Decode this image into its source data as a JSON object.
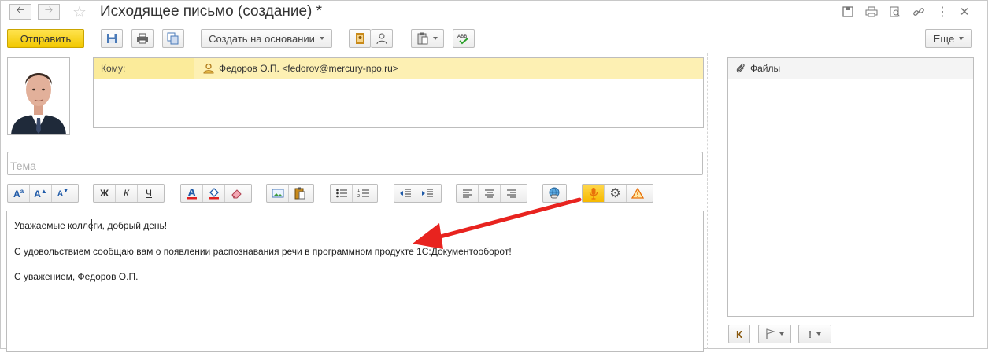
{
  "window": {
    "title": "Исходящее письмо (создание) *"
  },
  "toolbar": {
    "send_label": "Отправить",
    "create_based_label": "Создать на основании",
    "more_label": "Еще"
  },
  "recipients": {
    "to_label": "Кому:",
    "to_value": "Федоров О.П. <fedorov@mercury-npo.ru>"
  },
  "subject": {
    "placeholder": "Тема",
    "value": ""
  },
  "format_toolbar": {
    "bold": "Ж",
    "italic": "К",
    "underline": "Ч"
  },
  "body": {
    "line1": "Уважаемые коллеги, добрый день!",
    "line2": "С удовольствием сообщаю вам о появлении распознавания  речи в программном продукте 1С:Документооборот!",
    "line3": "С уважением, Федоров О.П."
  },
  "files": {
    "title": "Файлы"
  },
  "bottom_buttons": {
    "k_label": "К",
    "exclaim_label": "!"
  },
  "colors": {
    "accent_yellow": "#f6c800",
    "recipient_highlight": "#fbeb9a",
    "annotation_arrow": "#e8231f"
  },
  "icons": [
    "back-icon",
    "forward-icon",
    "star-icon",
    "save-icon",
    "print-icon",
    "copy-icon",
    "clipboard-icon",
    "spellcheck-icon",
    "microphone-icon",
    "gear-icon",
    "warning-icon",
    "paperclip-icon",
    "flag-icon",
    "link-icon",
    "menu-icon",
    "close-icon"
  ]
}
